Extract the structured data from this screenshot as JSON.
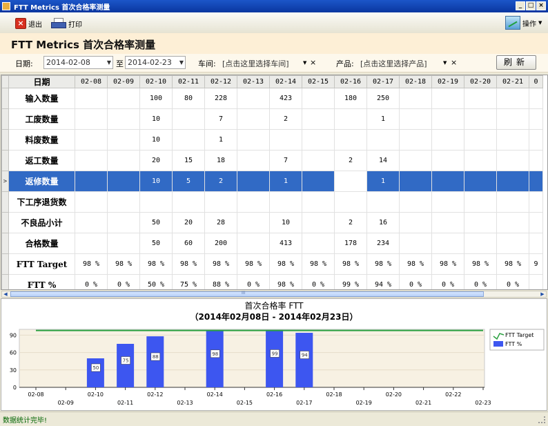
{
  "window": {
    "title": "FTT Metrics 首次合格率测量"
  },
  "toolbar": {
    "exit_label": "退出",
    "print_label": "打印",
    "ops_label": "操作"
  },
  "page": {
    "heading": "FTT Metrics 首次合格率测量"
  },
  "filters": {
    "date_label": "日期:",
    "date_from": "2014-02-08",
    "date_to_label": "至",
    "date_to": "2014-02-23",
    "workshop_label": "车间:",
    "workshop_value": "[点击这里选择车间]",
    "product_label": "产品:",
    "product_value": "[点击这里选择产品]",
    "clear_mark": "×",
    "refresh_label": "刷新"
  },
  "grid": {
    "corner_label": "日期",
    "columns": [
      "02-08",
      "02-09",
      "02-10",
      "02-11",
      "02-12",
      "02-13",
      "02-14",
      "02-15",
      "02-16",
      "02-17",
      "02-18",
      "02-19",
      "02-20",
      "02-21",
      "0"
    ],
    "rows": [
      {
        "label": "输入数量",
        "cells": [
          "",
          "",
          "100",
          "80",
          "228",
          "",
          "423",
          "",
          "180",
          "250",
          "",
          "",
          "",
          "",
          ""
        ]
      },
      {
        "label": "工废数量",
        "cells": [
          "",
          "",
          "10",
          "",
          "7",
          "",
          "2",
          "",
          "",
          "1",
          "",
          "",
          "",
          "",
          ""
        ]
      },
      {
        "label": "料废数量",
        "cells": [
          "",
          "",
          "10",
          "",
          "1",
          "",
          "",
          "",
          "",
          "",
          "",
          "",
          "",
          "",
          ""
        ]
      },
      {
        "label": "返工数量",
        "cells": [
          "",
          "",
          "20",
          "15",
          "18",
          "",
          "7",
          "",
          "2",
          "14",
          "",
          "",
          "",
          "",
          ""
        ]
      },
      {
        "label": "返修数量",
        "cells": [
          "",
          "",
          "10",
          "5",
          "2",
          "",
          "1",
          "",
          "",
          "1",
          "",
          "",
          "",
          "",
          ""
        ]
      },
      {
        "label": "下工序退货数",
        "cells": [
          "",
          "",
          "",
          "",
          "",
          "",
          "",
          "",
          "",
          "",
          "",
          "",
          "",
          "",
          ""
        ]
      },
      {
        "label": "不良品小计",
        "cells": [
          "",
          "",
          "50",
          "20",
          "28",
          "",
          "10",
          "",
          "2",
          "16",
          "",
          "",
          "",
          "",
          ""
        ]
      },
      {
        "label": "合格数量",
        "cells": [
          "",
          "",
          "50",
          "60",
          "200",
          "",
          "413",
          "",
          "178",
          "234",
          "",
          "",
          "",
          "",
          ""
        ]
      },
      {
        "label": "FTT Target",
        "cells": [
          "98 %",
          "98 %",
          "98 %",
          "98 %",
          "98 %",
          "98 %",
          "98 %",
          "98 %",
          "98 %",
          "98 %",
          "98 %",
          "98 %",
          "98 %",
          "98 %",
          "9"
        ]
      },
      {
        "label": "FTT %",
        "cells": [
          "0 %",
          "0 %",
          "50 %",
          "75 %",
          "88 %",
          "0 %",
          "98 %",
          "0 %",
          "99 %",
          "94 %",
          "0 %",
          "0 %",
          "0 %",
          "0 %",
          ""
        ]
      }
    ],
    "selected_row_index": 4,
    "current_row_marker": ">",
    "scroll_mark": "III"
  },
  "chart_data": {
    "type": "bar",
    "title": "首次合格率 FTT",
    "subtitle": "（2014年02月08日 - 2014年02月23日）",
    "categories": [
      "02-08",
      "02-09",
      "02-10",
      "02-11",
      "02-12",
      "02-13",
      "02-14",
      "02-15",
      "02-16",
      "02-17",
      "02-18",
      "02-19",
      "02-20",
      "02-21",
      "02-22",
      "02-23"
    ],
    "series": [
      {
        "name": "FTT %",
        "type": "bar",
        "color": "#3d56f0",
        "values": [
          0,
          0,
          50,
          75,
          88,
          0,
          98,
          0,
          99,
          94,
          0,
          0,
          0,
          0,
          0,
          0
        ],
        "labels": [
          "",
          "",
          "50",
          "75",
          "88",
          "",
          "98",
          "",
          "99",
          "94",
          "",
          "",
          "",
          "",
          "",
          ""
        ]
      },
      {
        "name": "FTT Target",
        "type": "line",
        "color": "#2aa040",
        "values": [
          98,
          98,
          98,
          98,
          98,
          98,
          98,
          98,
          98,
          98,
          98,
          98,
          98,
          98,
          98,
          98
        ]
      }
    ],
    "ylim": [
      0,
      100
    ],
    "yticks": [
      "0",
      "30",
      "60",
      "90"
    ],
    "legend_position": "right",
    "background": "#f7f1e3"
  },
  "status": {
    "text": "数据统计完毕!"
  },
  "colors": {
    "selection": "#316ac5",
    "header_band": "#fdefd6",
    "status_text": "#006400"
  }
}
